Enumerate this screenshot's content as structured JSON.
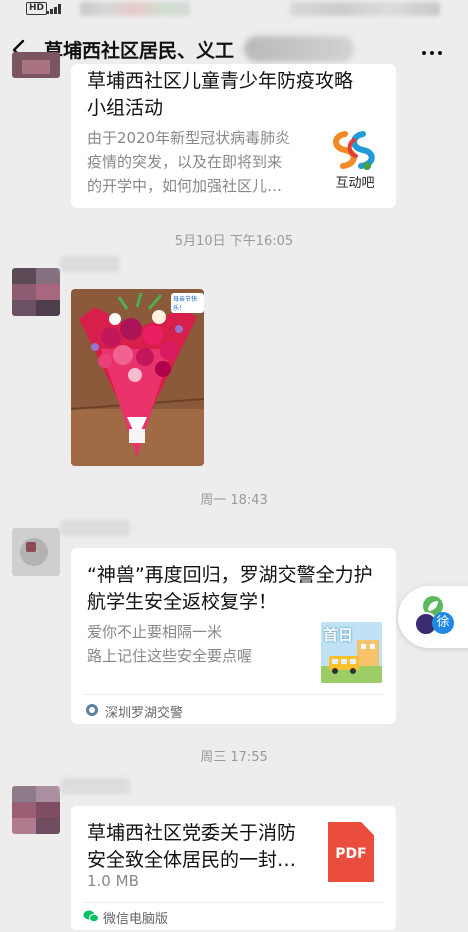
{
  "statusbar": {
    "hd": "HD"
  },
  "header": {
    "title": "草埔西社区居民、义工"
  },
  "messages": {
    "article1": {
      "title_line1": "草埔西社区儿童青少年防疫攻略",
      "title_line2": "小组活动",
      "desc_line1": "由于2020年新型冠状病毒肺炎",
      "desc_line2": "疫情的突发，以及在即将到来",
      "desc_line3": "的开学中，如何加强社区儿…",
      "logo_text": "互动吧"
    },
    "time1": "5月10日 下午16:05",
    "photo": {
      "tag": "母亲节快乐！"
    },
    "time2": "周一 18:43",
    "article2": {
      "title_line1": "“神兽”再度回归，罗湖交警全力护",
      "title_line2": "航学生安全返校复学！",
      "desc_line1": "爱你不止要相隔一米",
      "desc_line2": "路上记住这些安全要点喔",
      "thumb_text": "首日",
      "source": "深圳罗湖交警"
    },
    "time3": "周三 17:55",
    "file": {
      "name_line1": "草埔西社区党委关于消防",
      "name_line2": "安全致全体居民的一封…",
      "size": "1.0 MB",
      "icon_label": "PDF",
      "source": "微信电脑版"
    }
  },
  "float_button": {
    "text": "徐"
  },
  "colors": {
    "background": "#ededed",
    "pdf_red": "#ea4c3e",
    "wechat_green": "#07c160"
  }
}
